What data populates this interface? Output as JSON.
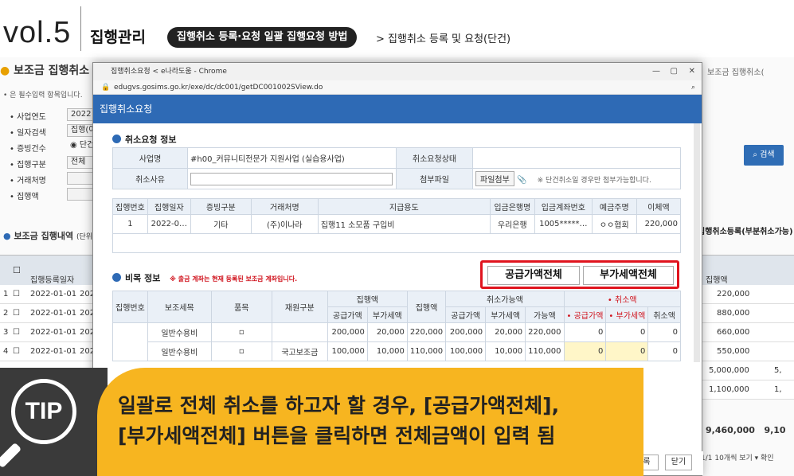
{
  "header": {
    "vol": "vol.5",
    "title": "집행관리",
    "pill": "집행취소 등록·요청 일괄 집행요청 방법",
    "crumb": "> 집행취소 등록 및 요청(단건)"
  },
  "background": {
    "title": "보조금 집행취소",
    "note": "• 은 필수입력 항목입니다.",
    "filters": [
      {
        "label": "• 사업연도",
        "value": "2022"
      },
      {
        "label": "• 일자검색",
        "value": "집행(이"
      },
      {
        "label": "• 증빙건수",
        "value": "◉ 단건"
      },
      {
        "label": "• 집행구분",
        "value": "전체"
      },
      {
        "label": "• 거래처명",
        "value": ""
      },
      {
        "label": "• 집행액",
        "value": ""
      }
    ],
    "search_button": "검색",
    "right_top": "보조금 집행취소(",
    "list_title": "보조금 집행내역",
    "list_sub": "(단위",
    "right_button": "집행취소등록(부분취소가능)",
    "col_date": "집행등록일자",
    "col_amount": "집행액",
    "rows": [
      {
        "no": "1",
        "date": "2022-01-01",
        "cut": "202",
        "amount": "220,000",
        "extra": ""
      },
      {
        "no": "2",
        "date": "2022-01-01",
        "cut": "202",
        "amount": "880,000",
        "extra": ""
      },
      {
        "no": "3",
        "date": "2022-01-01",
        "cut": "202",
        "amount": "660,000",
        "extra": ""
      },
      {
        "no": "4",
        "date": "2022-01-01",
        "cut": "202",
        "amount": "550,000",
        "extra": ""
      },
      {
        "no": "",
        "date": "",
        "cut": "",
        "amount": "5,000,000",
        "extra": "5,"
      },
      {
        "no": "",
        "date": "",
        "cut": "",
        "amount": "1,100,000",
        "extra": "1,"
      }
    ],
    "total": "9,460,000",
    "total_extra": "9,10",
    "pager": "1/1  10개씩 보기 ▾  확인"
  },
  "popup": {
    "window_title": "집행취소요청 < e나라도움 - Chrome",
    "address": "edugvs.gosims.go.kr/exe/dc/dc001/getDC001002SView.do",
    "bar_title": "집행취소요청",
    "section1": "취소요청 정보",
    "info": {
      "biz_label": "사업명",
      "biz_value": "#h00_커뮤니티전문가 지원사업 (실습용사업)",
      "status_label": "취소요청상태",
      "status_value": "",
      "reason_label": "취소사유",
      "file_label": "첨부파일",
      "file_button": "파일첨부",
      "file_note": "※ 단건취소일 경우만 첨부가능합니다."
    },
    "exec_cols": [
      "집행번호",
      "집행일자",
      "증빙구분",
      "거래처명",
      "지급용도",
      "입금은행명",
      "입금계좌번호",
      "예금주명",
      "이체액"
    ],
    "exec_row": [
      "1",
      "2022-0…",
      "기타",
      "(주)이나라",
      "집행11 소모품 구입비",
      "우리은행",
      "1005*****…",
      "ㅇㅇ협회",
      "220,000"
    ],
    "section2": "비목 정보",
    "section2_note": "※ 출금 계좌는 현재 등록된 보조금 계좌입니다.",
    "btn_supply": "공급가액전체",
    "btn_vat": "부가세액전체",
    "item_cols": {
      "no": "집행번호",
      "cat": "보조세목",
      "item": "품목",
      "src": "재원구분",
      "exec": "집행액",
      "exec_sum": "집행액",
      "cancelable": "취소가능액",
      "cancel": "• 취소액",
      "supply": "공급가액",
      "vat": "부가세액",
      "avail": "가능액",
      "c_supply": "• 공급가액",
      "c_vat": "• 부가세액",
      "c_total": "취소액"
    },
    "item_rows": [
      [
        "일반수용비",
        "▫",
        "",
        "200,000",
        "20,000",
        "220,000",
        "200,000",
        "20,000",
        "220,000",
        "0",
        "0",
        "0"
      ],
      [
        "일반수용비",
        "▫",
        "국고보조금",
        "100,000",
        "10,000",
        "110,000",
        "100,000",
        "10,000",
        "110,000",
        "0",
        "0",
        "0"
      ]
    ],
    "footer_btn1": "록",
    "footer_btn2": "닫기"
  },
  "tip": {
    "badge": "TIP",
    "line1": "일괄로 전체 취소를 하고자 할 경우, [공급가액전체],",
    "line2": "[부가세액전체] 버튼을 클릭하면 전체금액이 입력 됨"
  }
}
